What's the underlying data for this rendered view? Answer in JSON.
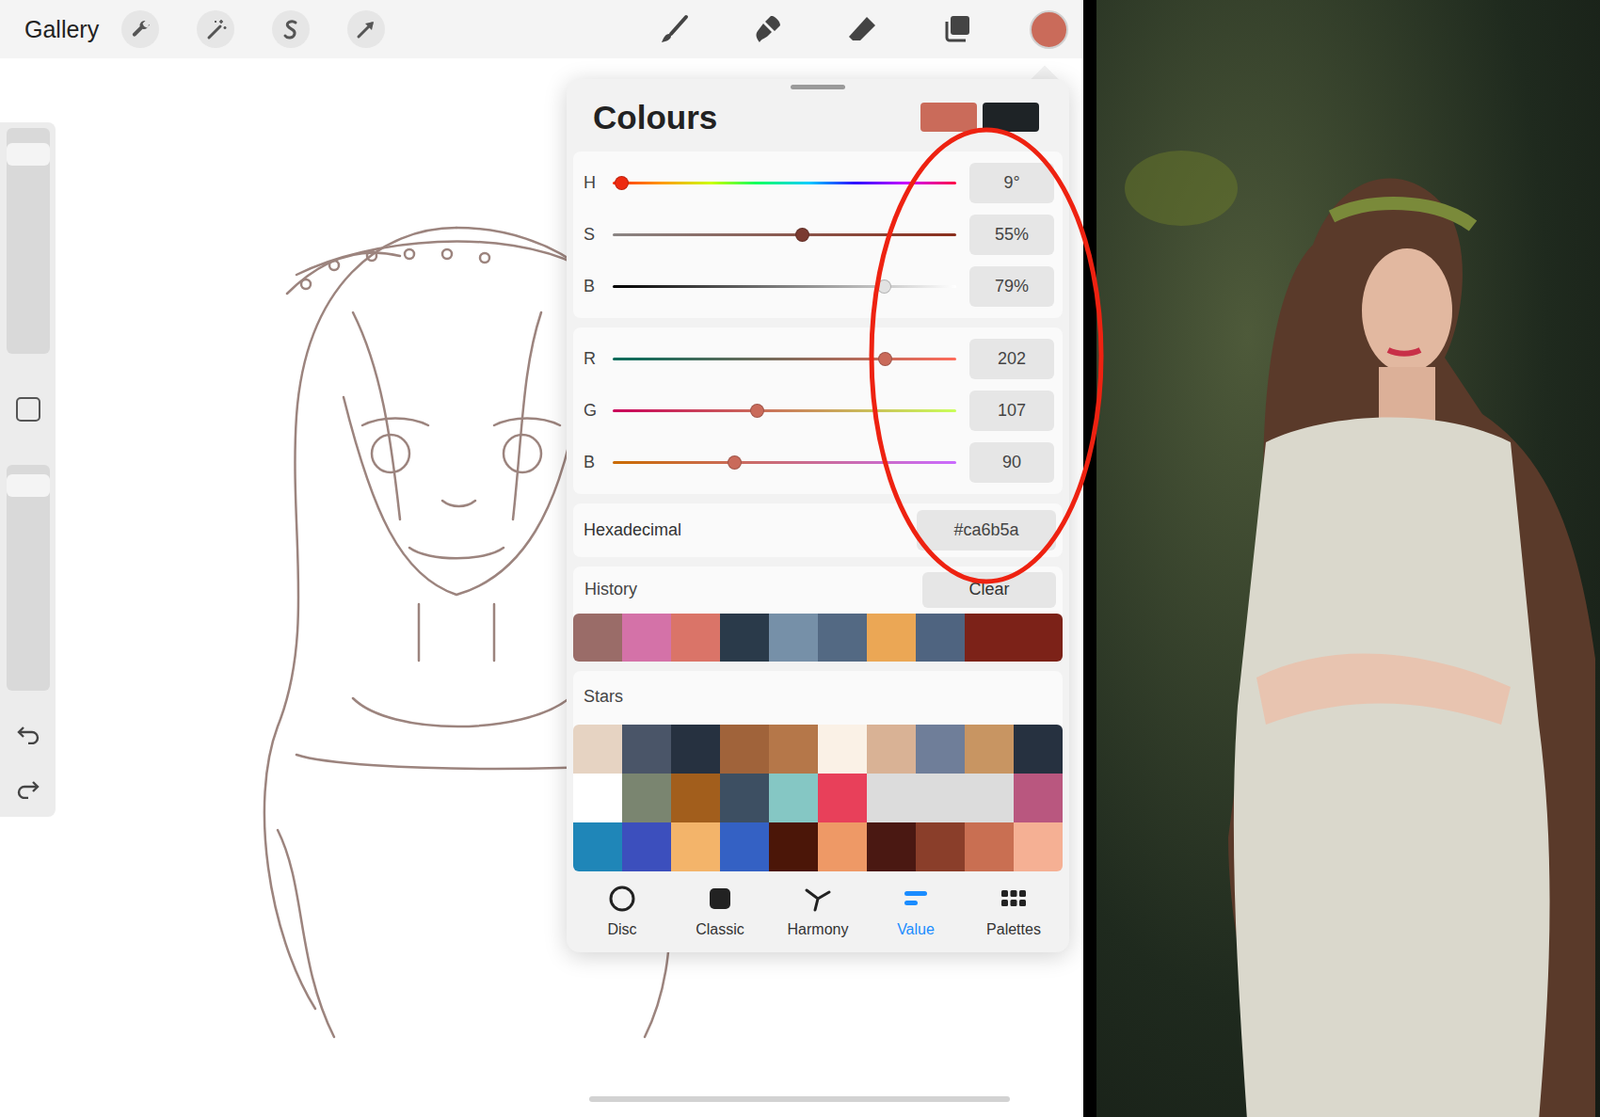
{
  "toolbar": {
    "gallery": "Gallery",
    "current_color": "#ca6b5a"
  },
  "colours": {
    "title": "Colours",
    "primary_color": "#ca6b5a",
    "secondary_color": "#1e2326",
    "hsb": [
      {
        "label": "H",
        "level": 0.025,
        "reading": "9°"
      },
      {
        "label": "S",
        "level": 0.55,
        "reading": "55%"
      },
      {
        "label": "B",
        "level": 0.79,
        "reading": "79%"
      }
    ],
    "rgb": [
      {
        "label": "R",
        "level": 0.792,
        "reading": "202"
      },
      {
        "label": "G",
        "level": 0.42,
        "reading": "107"
      },
      {
        "label": "B",
        "level": 0.353,
        "reading": "90"
      }
    ],
    "hex": {
      "label": "Hexadecimal",
      "value": "#ca6b5a"
    },
    "history": {
      "label": "History",
      "clear": "Clear",
      "colors": [
        "#9a6c68",
        "#d472a8",
        "#da7468",
        "#2a3a4a",
        "#7690a8",
        "#536983",
        "#eba755",
        "#4f6480",
        "#7c2218",
        "#7c2218"
      ]
    },
    "palette": {
      "name": "Stars",
      "colors": [
        "#e6d3c2",
        "#4a5568",
        "#263140",
        "#a0633a",
        "#b57749",
        "#faf1e6",
        "#d9b295",
        "#6f7e99",
        "#c89562",
        "#263140",
        "#ffffff",
        "#7a8570",
        "#a25e1c",
        "#3d4f62",
        "#85c7c4",
        "#e8405a",
        "#dcdcdc",
        "#dcdcdc",
        "#dcdcdc",
        "#b9577f",
        "#1f86b8",
        "#3c4fbd",
        "#f3b46a",
        "#3461c4",
        "#4b1608",
        "#ee9966",
        "#4a1812",
        "#8a3e2a",
        "#c96f52",
        "#f5b094"
      ]
    },
    "tabs": [
      {
        "label": "Disc",
        "selected": false
      },
      {
        "label": "Classic",
        "selected": false
      },
      {
        "label": "Harmony",
        "selected": false
      },
      {
        "label": "Value",
        "selected": true
      },
      {
        "label": "Palettes",
        "selected": false
      }
    ]
  }
}
